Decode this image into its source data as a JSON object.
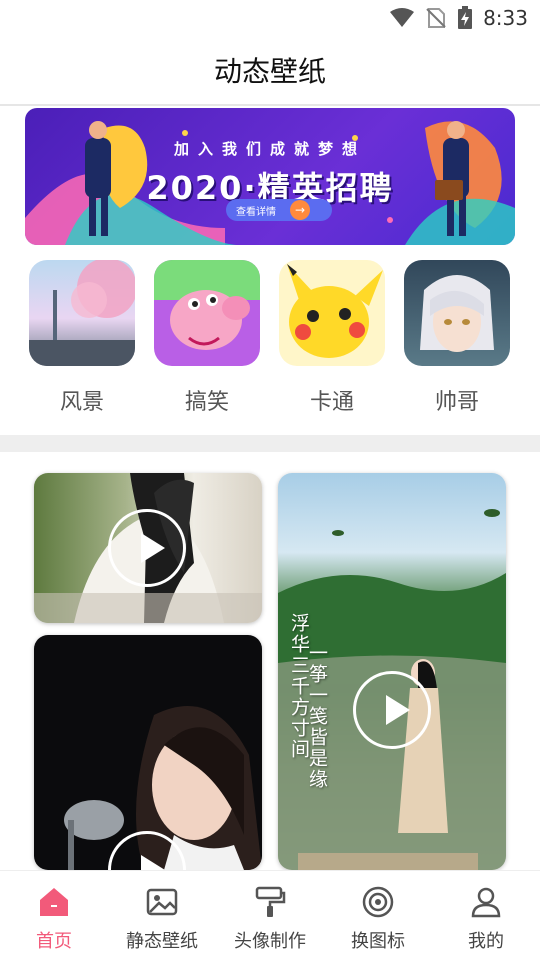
{
  "status": {
    "time": "8:33"
  },
  "header": {
    "title": "动态壁纸"
  },
  "banner": {
    "subtitle": "加入我们成就梦想",
    "title": "2020·精英招聘",
    "cta": "查看详情"
  },
  "categories": [
    {
      "label": "风景",
      "icon": "scenery-image"
    },
    {
      "label": "搞笑",
      "icon": "peppa-pig-image"
    },
    {
      "label": "卡通",
      "icon": "pikachu-image"
    },
    {
      "label": "帅哥",
      "icon": "anime-boy-image"
    }
  ],
  "videos": [
    {
      "id": "video-1"
    },
    {
      "id": "video-2",
      "poem_left": "浮华三千方寸间",
      "poem_right": "一筝一笺皆是缘"
    },
    {
      "id": "video-3"
    }
  ],
  "tabs": [
    {
      "label": "首页",
      "icon": "home-icon",
      "active": true
    },
    {
      "label": "静态壁纸",
      "icon": "image-icon",
      "active": false
    },
    {
      "label": "头像制作",
      "icon": "paint-roller-icon",
      "active": false
    },
    {
      "label": "换图标",
      "icon": "target-icon",
      "active": false
    },
    {
      "label": "我的",
      "icon": "user-icon",
      "active": false
    }
  ],
  "colors": {
    "accent": "#f25a7a",
    "banner": "#5a2bd0"
  }
}
